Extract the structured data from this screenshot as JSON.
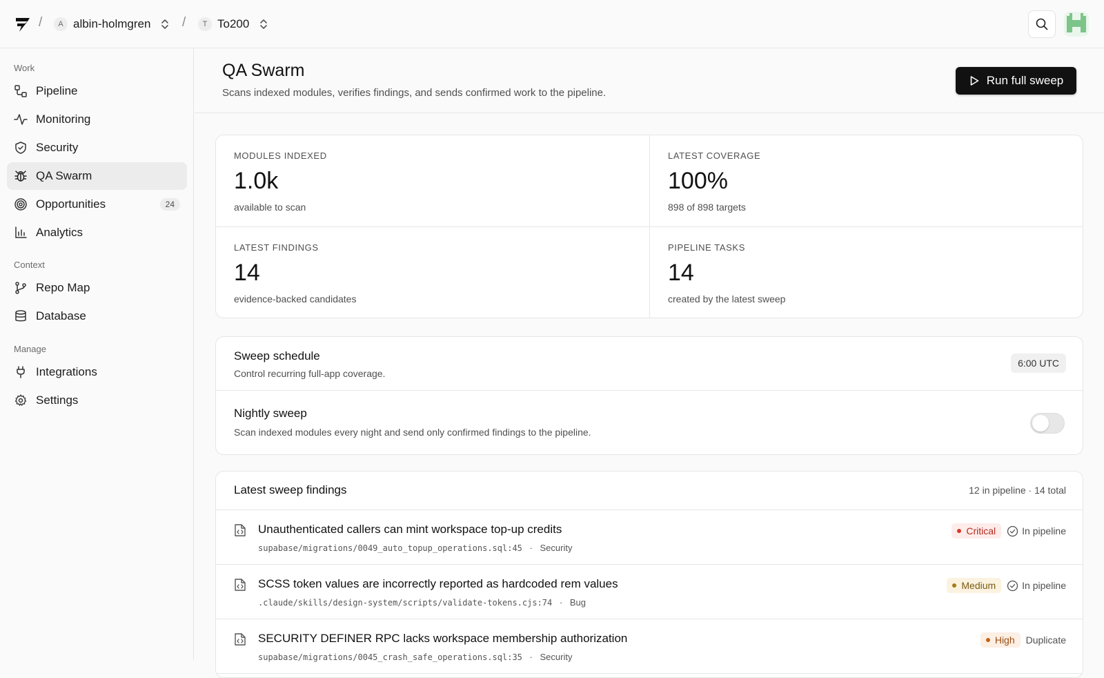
{
  "topbar": {
    "breadcrumb_sep": "/",
    "workspace": {
      "initial": "A",
      "name": "albin-holmgren"
    },
    "project": {
      "initial": "T",
      "name": "To200"
    }
  },
  "sidebar": {
    "sections": [
      {
        "label": "Work"
      },
      {
        "label": "Context"
      },
      {
        "label": "Manage"
      }
    ],
    "items": [
      {
        "label": "Pipeline",
        "icon": "pipeline-icon"
      },
      {
        "label": "Monitoring",
        "icon": "activity-icon"
      },
      {
        "label": "Security",
        "icon": "shield-icon"
      },
      {
        "label": "QA Swarm",
        "icon": "bug-icon",
        "active": true
      },
      {
        "label": "Opportunities",
        "icon": "target-icon",
        "badge": "24"
      },
      {
        "label": "Analytics",
        "icon": "bar-chart-icon"
      },
      {
        "label": "Repo Map",
        "icon": "git-branch-icon"
      },
      {
        "label": "Database",
        "icon": "database-icon"
      },
      {
        "label": "Integrations",
        "icon": "plug-icon"
      },
      {
        "label": "Settings",
        "icon": "gear-icon"
      }
    ]
  },
  "page": {
    "title": "QA Swarm",
    "subtitle": "Scans indexed modules, verifies findings, and sends confirmed work to the pipeline.",
    "run_button": "Run full sweep"
  },
  "stats": [
    {
      "label": "MODULES INDEXED",
      "value": "1.0k",
      "caption": "available to scan"
    },
    {
      "label": "LATEST COVERAGE",
      "value": "100%",
      "caption": "898 of 898 targets"
    },
    {
      "label": "LATEST FINDINGS",
      "value": "14",
      "caption": "evidence-backed candidates"
    },
    {
      "label": "PIPELINE TASKS",
      "value": "14",
      "caption": "created by the latest sweep"
    }
  ],
  "schedule": {
    "title": "Sweep schedule",
    "subtitle": "Control recurring full-app coverage.",
    "time": "6:00 UTC",
    "nightly_title": "Nightly sweep",
    "nightly_subtitle": "Scan indexed modules every night and send only confirmed findings to the pipeline.",
    "nightly_enabled": false
  },
  "findings": {
    "title": "Latest sweep findings",
    "count": "12 in pipeline · 14 total",
    "meta_sep": "·",
    "rows": [
      {
        "title": "Unauthenticated callers can mint workspace top-up credits",
        "path": "supabase/migrations/0049_auto_topup_operations.sql:45",
        "category": "Security",
        "severity": "Critical",
        "status": "In pipeline"
      },
      {
        "title": "SCSS token values are incorrectly reported as hardcoded rem values",
        "path": ".claude/skills/design-system/scripts/validate-tokens.cjs:74",
        "category": "Bug",
        "severity": "Medium",
        "status": "In pipeline"
      },
      {
        "title": "SECURITY DEFINER RPC lacks workspace membership authorization",
        "path": "supabase/migrations/0045_crash_safe_operations.sql:35",
        "category": "Security",
        "severity": "High",
        "status": "Duplicate"
      }
    ]
  },
  "colors": {
    "accent": "#111111",
    "critical": "#d2392b",
    "medium": "#a77a16",
    "high": "#c1621a",
    "avatar": "#7dc48a"
  }
}
